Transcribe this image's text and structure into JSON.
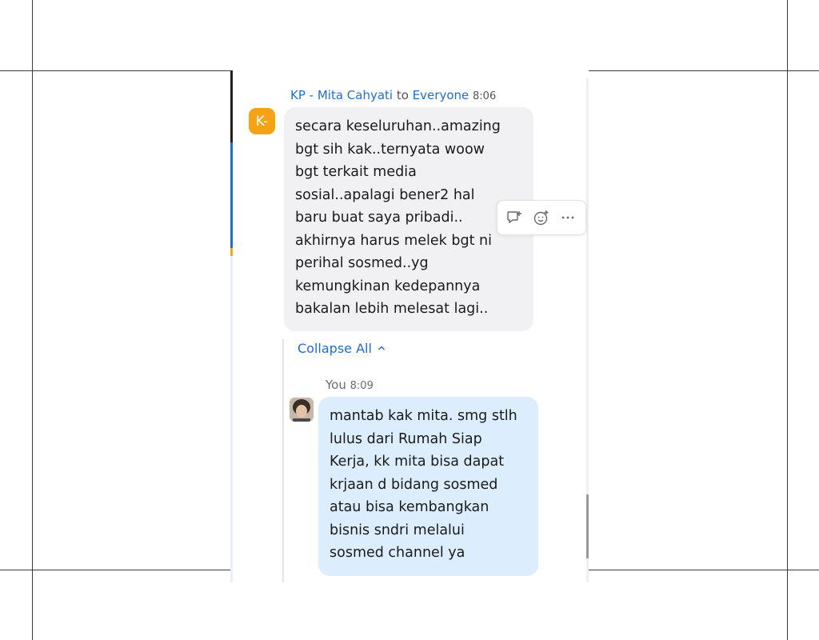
{
  "message": {
    "sender": "KP - Mita Cahyati",
    "to_word": "to",
    "recipient": "Everyone",
    "time": "8:06",
    "avatar_initial": "K-",
    "avatar_color": "#f4a316",
    "text": "secara keseluruhan..amazing\nbgt sih kak..ternyata woow\nbgt terkait media\nsosial..apalagi bener2 hal\nbaru buat saya pribadi..\nakhirnya harus melek bgt ni\nperihal sosmed..yg\nkemungkinan kedepannya\nbakalan lebih melesat lagi.."
  },
  "toolbar": {
    "icons": [
      "reply-thread-icon",
      "add-reaction-icon",
      "more-options-icon"
    ]
  },
  "thread": {
    "collapse_label": "Collapse All",
    "collapse_icon": "chevron-up-icon"
  },
  "reply": {
    "sender": "You",
    "time": "8:09",
    "text": "mantab kak mita. smg stlh\nlulus dari Rumah Siap\nKerja, kk mita bisa dapat\nkrjaan d bidang sosmed\natau bisa kembangkan\nbisnis sndri melalui\nsosmed channel ya"
  },
  "colors": {
    "accent_blue": "#1f6ed4",
    "bubble_other": "#f1f1f4",
    "bubble_self": "#dcedfd"
  }
}
